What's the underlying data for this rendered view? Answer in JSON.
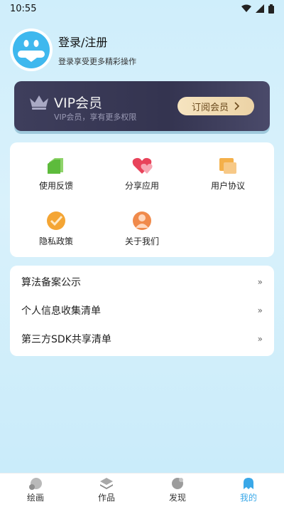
{
  "status_bar": {
    "time": "10:55"
  },
  "profile": {
    "title": "登录/注册",
    "subtitle": "登录享受更多精彩操作"
  },
  "vip": {
    "title": "VIP会员",
    "subtitle": "VIP会员，享有更多权限",
    "button_label": "订阅会员"
  },
  "grid": {
    "items": [
      {
        "label": "使用反馈",
        "icon": "feedback-icon"
      },
      {
        "label": "分享应用",
        "icon": "heart-share-icon"
      },
      {
        "label": "用户协议",
        "icon": "document-icon"
      },
      {
        "label": "隐私政策",
        "icon": "check-badge-icon"
      },
      {
        "label": "关于我们",
        "icon": "person-icon"
      }
    ]
  },
  "list": {
    "items": [
      {
        "label": "算法备案公示",
        "arrow": "»"
      },
      {
        "label": "个人信息收集清单",
        "arrow": "»"
      },
      {
        "label": "第三方SDK共享清单",
        "arrow": "»"
      }
    ]
  },
  "nav": {
    "items": [
      {
        "label": "绘画",
        "icon": "paint-icon"
      },
      {
        "label": "作品",
        "icon": "layers-icon"
      },
      {
        "label": "发现",
        "icon": "discover-icon"
      },
      {
        "label": "我的",
        "icon": "profile-icon"
      }
    ],
    "active_color": "#3aa8e8"
  },
  "colors": {
    "background": "#cfeefb",
    "vip_card": "#3e3e5c",
    "vip_button": "#f6e4c0"
  }
}
